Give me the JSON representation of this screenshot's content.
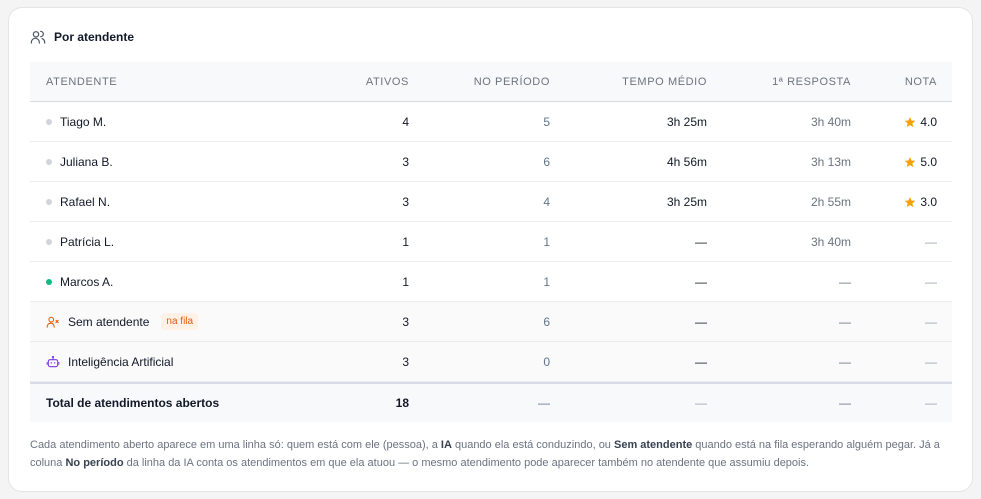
{
  "section": {
    "title": "Por atendente",
    "icon": "users-icon"
  },
  "columns": {
    "atendente": "ATENDENTE",
    "ativos": "ATIVOS",
    "periodo": "NO PERÍODO",
    "tempo": "TEMPO MÉDIO",
    "resposta": "1ª RESPOSTA",
    "nota": "NOTA"
  },
  "rows": [
    {
      "name": "Tiago M.",
      "status": "offline",
      "ativos": "4",
      "periodo": "5",
      "tempo": "3h 25m",
      "resposta": "3h 40m",
      "nota": "4.0"
    },
    {
      "name": "Juliana B.",
      "status": "offline",
      "ativos": "3",
      "periodo": "6",
      "tempo": "4h 56m",
      "resposta": "3h 13m",
      "nota": "5.0"
    },
    {
      "name": "Rafael N.",
      "status": "offline",
      "ativos": "3",
      "periodo": "4",
      "tempo": "3h 25m",
      "resposta": "2h 55m",
      "nota": "3.0"
    },
    {
      "name": "Patrícia L.",
      "status": "offline",
      "ativos": "1",
      "periodo": "1",
      "tempo": "—",
      "resposta": "3h 40m",
      "nota": "—"
    },
    {
      "name": "Marcos A.",
      "status": "online",
      "ativos": "1",
      "periodo": "1",
      "tempo": "—",
      "resposta": "—",
      "nota": "—"
    }
  ],
  "unassigned": {
    "name": "Sem atendente",
    "badge": "na fila",
    "icon": "user-x-icon",
    "ativos": "3",
    "periodo": "6",
    "tempo": "—",
    "resposta": "—",
    "nota": "—"
  },
  "ai": {
    "name": "Inteligência Artificial",
    "icon": "bot-icon",
    "ativos": "3",
    "periodo": "0",
    "tempo": "—",
    "resposta": "—",
    "nota": "—"
  },
  "total": {
    "label": "Total de atendimentos abertos",
    "ativos": "18",
    "periodo": "—",
    "tempo": "—",
    "resposta": "—",
    "nota": "—"
  },
  "footnote": {
    "p1": "Cada atendimento aberto aparece em uma linha só: quem está com ele (pessoa), a ",
    "b1": "IA",
    "p2": " quando ela está conduzindo, ou ",
    "b2": "Sem atendente",
    "p3": " quando está na fila esperando alguém pegar. Já a coluna ",
    "b3": "No período",
    "p4": " da linha da IA conta os atendimentos em que ela atuou — o mesmo atendimento pode aparecer também no atendente que assumiu depois."
  },
  "colors": {
    "star": "#f59e0b",
    "online": "#10b981",
    "badge": "#ea580c",
    "ai_icon": "#7c3aed"
  }
}
